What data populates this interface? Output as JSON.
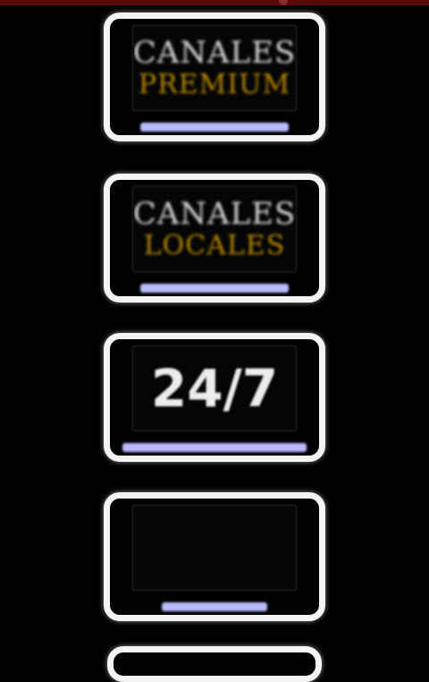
{
  "header": {
    "bar_color": "#5a0a0a"
  },
  "tiles": [
    {
      "line1": "CANALES",
      "line2": "PREMIUM",
      "caption": ""
    },
    {
      "line1": "CANALES",
      "line2": "LOCALES",
      "caption": ""
    },
    {
      "big": "24/7",
      "small": "",
      "caption": ""
    },
    {
      "gold": "",
      "caption": ""
    }
  ],
  "colors": {
    "background": "#000000",
    "tile_border": "#f4f4f4",
    "white_text": "#d9d9d9",
    "gold_text": "#b88a00",
    "caption_text": "#b9b9ff"
  }
}
